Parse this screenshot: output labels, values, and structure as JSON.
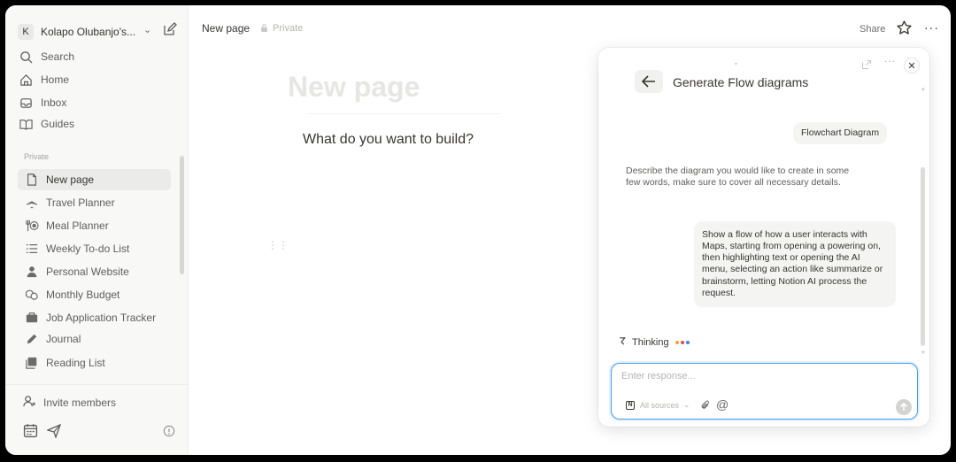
{
  "sidebar": {
    "workspace": {
      "initial": "K",
      "name": "Kolapo Olubanjo's..."
    },
    "nav": [
      {
        "label": "Search",
        "icon": "search-icon"
      },
      {
        "label": "Home",
        "icon": "home-icon"
      },
      {
        "label": "Inbox",
        "icon": "inbox-icon"
      },
      {
        "label": "Guides",
        "icon": "book-icon"
      }
    ],
    "section_label": "Private",
    "pages": [
      {
        "label": "New page",
        "icon": "page-icon",
        "active": true
      },
      {
        "label": "Travel Planner",
        "icon": "airplane-icon"
      },
      {
        "label": "Meal Planner",
        "icon": "utensils-icon"
      },
      {
        "label": "Weekly To-do List",
        "icon": "list-icon"
      },
      {
        "label": "Personal Website",
        "icon": "person-icon"
      },
      {
        "label": "Monthly Budget",
        "icon": "coins-icon"
      },
      {
        "label": "Job Application Tracker",
        "icon": "briefcase-icon"
      },
      {
        "label": "Journal",
        "icon": "pencil-icon"
      },
      {
        "label": "Reading List",
        "icon": "books-icon"
      }
    ],
    "invite_label": "Invite members"
  },
  "topbar": {
    "breadcrumb": "New page",
    "privacy": "Private",
    "share_label": "Share"
  },
  "main": {
    "title": "New page",
    "prompt": "What do you want to build?"
  },
  "ai_panel": {
    "title": "Generate Flow diagrams",
    "user_chip": "Flowchart Diagram",
    "assistant_message": "Describe the diagram you would like to create in some few words, make sure to cover all necessary details.",
    "user_message": "Show a flow of how a user interacts with Maps, starting from opening a powering on, then highlighting text or opening the AI menu, selecting an action like summarize or brainstorm, letting Notion AI process the request.",
    "status": "Thinking",
    "input_placeholder": "Enter response...",
    "sources_label": "All sources"
  },
  "colors": {
    "accent": "#4a9de8",
    "thinking_dots": [
      "#f2a33a",
      "#e5484d",
      "#3b82f6"
    ]
  }
}
